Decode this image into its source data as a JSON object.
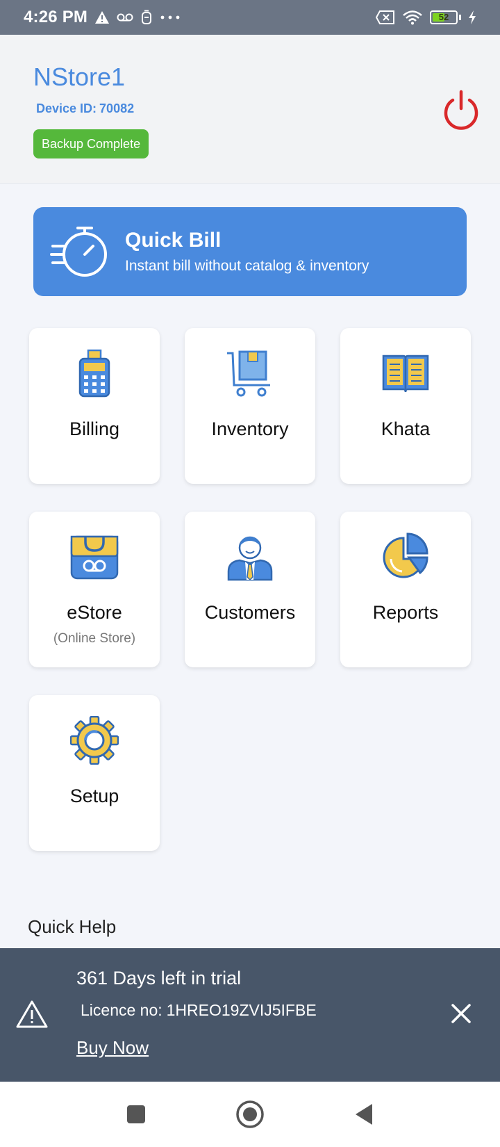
{
  "status_bar": {
    "time": "4:26 PM",
    "battery": "52",
    "icons": [
      "warning-icon",
      "voicemail-icon",
      "vpn-icon",
      "more-icon",
      "sim-off-icon",
      "wifi-icon",
      "battery-icon",
      "charging-icon"
    ]
  },
  "header": {
    "store_name": "NStore1",
    "device_label": "Device ID:",
    "device_id": "70082",
    "backup_status": "Backup Complete",
    "power_color": "#d9282a"
  },
  "quick_bill": {
    "title": "Quick Bill",
    "subtitle": "Instant bill without catalog & inventory",
    "color": "#4a8ade"
  },
  "tiles": [
    {
      "label": "Billing",
      "icon": "billing-machine-icon"
    },
    {
      "label": "Inventory",
      "icon": "inventory-cart-icon"
    },
    {
      "label": "Khata",
      "icon": "ledger-book-icon"
    },
    {
      "label": "eStore",
      "sub": "(Online Store)",
      "icon": "shopping-bag-icon"
    },
    {
      "label": "Customers",
      "icon": "customer-person-icon"
    },
    {
      "label": "Reports",
      "icon": "pie-chart-icon"
    },
    {
      "label": "Setup",
      "icon": "gear-icon"
    }
  ],
  "quick_help": "Quick Help",
  "trial": {
    "days_left": "361 Days left in trial",
    "licence_label": "Licence no:",
    "licence_no": "1HREO19ZVIJ5IFBE",
    "buy_now": " Buy Now"
  },
  "colors": {
    "accent_blue": "#4a8ade",
    "icon_blue": "#3f7fcf",
    "icon_yellow": "#f2c94c",
    "backup_green": "#55b83b",
    "banner_bg": "#485669"
  }
}
